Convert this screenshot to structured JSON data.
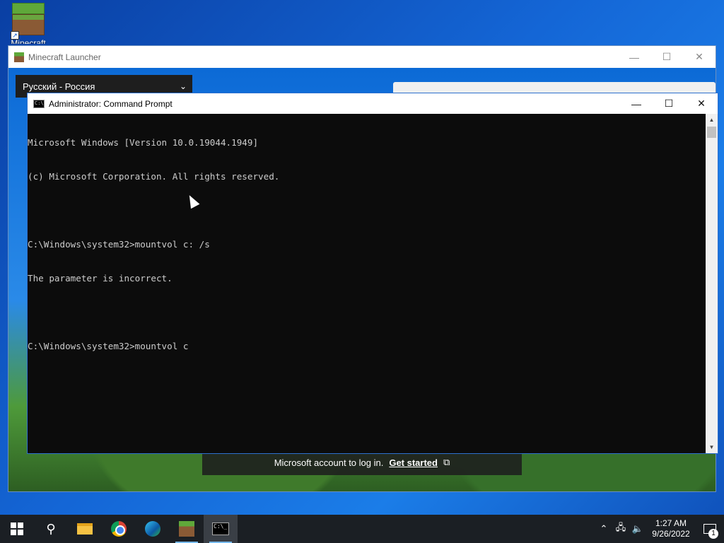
{
  "desktop": {
    "icons": [
      {
        "label": "Minecraft",
        "icon": "minecraft-grass-block-icon"
      }
    ]
  },
  "launcher": {
    "title": "Minecraft Launcher",
    "language_select": {
      "value": "Русский - Россия"
    },
    "promo": {
      "text": "Microsoft account to log in.",
      "link": "Get started"
    }
  },
  "cmd": {
    "title": "Administrator: Command Prompt",
    "lines": [
      "Microsoft Windows [Version 10.0.19044.1949]",
      "(c) Microsoft Corporation. All rights reserved.",
      "",
      "C:\\Windows\\system32>mountvol c: /s",
      "The parameter is incorrect.",
      "",
      "C:\\Windows\\system32>mountvol c"
    ]
  },
  "taskbar": {
    "items": [
      {
        "name": "start",
        "icon": "windows-logo-icon"
      },
      {
        "name": "search",
        "icon": "search-icon"
      },
      {
        "name": "file-explorer",
        "icon": "folder-icon"
      },
      {
        "name": "chrome",
        "icon": "chrome-icon"
      },
      {
        "name": "edge",
        "icon": "edge-icon"
      },
      {
        "name": "minecraft",
        "icon": "minecraft-icon"
      },
      {
        "name": "command-prompt",
        "icon": "cmd-icon"
      }
    ],
    "clock": {
      "time": "1:27 AM",
      "date": "9/26/2022"
    },
    "notifications_count": "1"
  },
  "colors": {
    "console_bg": "#0c0c0c",
    "console_text": "#cccccc",
    "taskbar_bg": "#1b1f24",
    "accent": "#76b9ed"
  }
}
